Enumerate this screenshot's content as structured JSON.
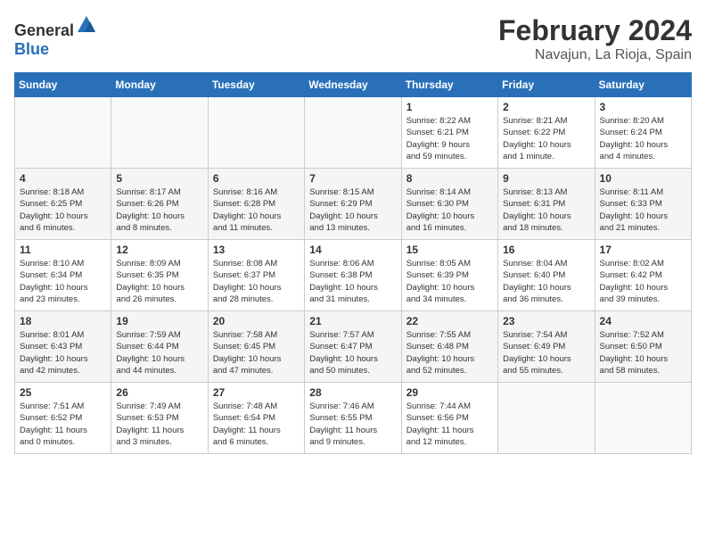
{
  "header": {
    "logo_general": "General",
    "logo_blue": "Blue",
    "month_title": "February 2024",
    "location": "Navajun, La Rioja, Spain"
  },
  "days_of_week": [
    "Sunday",
    "Monday",
    "Tuesday",
    "Wednesday",
    "Thursday",
    "Friday",
    "Saturday"
  ],
  "weeks": [
    [
      {
        "day": "",
        "info": ""
      },
      {
        "day": "",
        "info": ""
      },
      {
        "day": "",
        "info": ""
      },
      {
        "day": "",
        "info": ""
      },
      {
        "day": "1",
        "info": "Sunrise: 8:22 AM\nSunset: 6:21 PM\nDaylight: 9 hours\nand 59 minutes."
      },
      {
        "day": "2",
        "info": "Sunrise: 8:21 AM\nSunset: 6:22 PM\nDaylight: 10 hours\nand 1 minute."
      },
      {
        "day": "3",
        "info": "Sunrise: 8:20 AM\nSunset: 6:24 PM\nDaylight: 10 hours\nand 4 minutes."
      }
    ],
    [
      {
        "day": "4",
        "info": "Sunrise: 8:18 AM\nSunset: 6:25 PM\nDaylight: 10 hours\nand 6 minutes."
      },
      {
        "day": "5",
        "info": "Sunrise: 8:17 AM\nSunset: 6:26 PM\nDaylight: 10 hours\nand 8 minutes."
      },
      {
        "day": "6",
        "info": "Sunrise: 8:16 AM\nSunset: 6:28 PM\nDaylight: 10 hours\nand 11 minutes."
      },
      {
        "day": "7",
        "info": "Sunrise: 8:15 AM\nSunset: 6:29 PM\nDaylight: 10 hours\nand 13 minutes."
      },
      {
        "day": "8",
        "info": "Sunrise: 8:14 AM\nSunset: 6:30 PM\nDaylight: 10 hours\nand 16 minutes."
      },
      {
        "day": "9",
        "info": "Sunrise: 8:13 AM\nSunset: 6:31 PM\nDaylight: 10 hours\nand 18 minutes."
      },
      {
        "day": "10",
        "info": "Sunrise: 8:11 AM\nSunset: 6:33 PM\nDaylight: 10 hours\nand 21 minutes."
      }
    ],
    [
      {
        "day": "11",
        "info": "Sunrise: 8:10 AM\nSunset: 6:34 PM\nDaylight: 10 hours\nand 23 minutes."
      },
      {
        "day": "12",
        "info": "Sunrise: 8:09 AM\nSunset: 6:35 PM\nDaylight: 10 hours\nand 26 minutes."
      },
      {
        "day": "13",
        "info": "Sunrise: 8:08 AM\nSunset: 6:37 PM\nDaylight: 10 hours\nand 28 minutes."
      },
      {
        "day": "14",
        "info": "Sunrise: 8:06 AM\nSunset: 6:38 PM\nDaylight: 10 hours\nand 31 minutes."
      },
      {
        "day": "15",
        "info": "Sunrise: 8:05 AM\nSunset: 6:39 PM\nDaylight: 10 hours\nand 34 minutes."
      },
      {
        "day": "16",
        "info": "Sunrise: 8:04 AM\nSunset: 6:40 PM\nDaylight: 10 hours\nand 36 minutes."
      },
      {
        "day": "17",
        "info": "Sunrise: 8:02 AM\nSunset: 6:42 PM\nDaylight: 10 hours\nand 39 minutes."
      }
    ],
    [
      {
        "day": "18",
        "info": "Sunrise: 8:01 AM\nSunset: 6:43 PM\nDaylight: 10 hours\nand 42 minutes."
      },
      {
        "day": "19",
        "info": "Sunrise: 7:59 AM\nSunset: 6:44 PM\nDaylight: 10 hours\nand 44 minutes."
      },
      {
        "day": "20",
        "info": "Sunrise: 7:58 AM\nSunset: 6:45 PM\nDaylight: 10 hours\nand 47 minutes."
      },
      {
        "day": "21",
        "info": "Sunrise: 7:57 AM\nSunset: 6:47 PM\nDaylight: 10 hours\nand 50 minutes."
      },
      {
        "day": "22",
        "info": "Sunrise: 7:55 AM\nSunset: 6:48 PM\nDaylight: 10 hours\nand 52 minutes."
      },
      {
        "day": "23",
        "info": "Sunrise: 7:54 AM\nSunset: 6:49 PM\nDaylight: 10 hours\nand 55 minutes."
      },
      {
        "day": "24",
        "info": "Sunrise: 7:52 AM\nSunset: 6:50 PM\nDaylight: 10 hours\nand 58 minutes."
      }
    ],
    [
      {
        "day": "25",
        "info": "Sunrise: 7:51 AM\nSunset: 6:52 PM\nDaylight: 11 hours\nand 0 minutes."
      },
      {
        "day": "26",
        "info": "Sunrise: 7:49 AM\nSunset: 6:53 PM\nDaylight: 11 hours\nand 3 minutes."
      },
      {
        "day": "27",
        "info": "Sunrise: 7:48 AM\nSunset: 6:54 PM\nDaylight: 11 hours\nand 6 minutes."
      },
      {
        "day": "28",
        "info": "Sunrise: 7:46 AM\nSunset: 6:55 PM\nDaylight: 11 hours\nand 9 minutes."
      },
      {
        "day": "29",
        "info": "Sunrise: 7:44 AM\nSunset: 6:56 PM\nDaylight: 11 hours\nand 12 minutes."
      },
      {
        "day": "",
        "info": ""
      },
      {
        "day": "",
        "info": ""
      }
    ]
  ]
}
